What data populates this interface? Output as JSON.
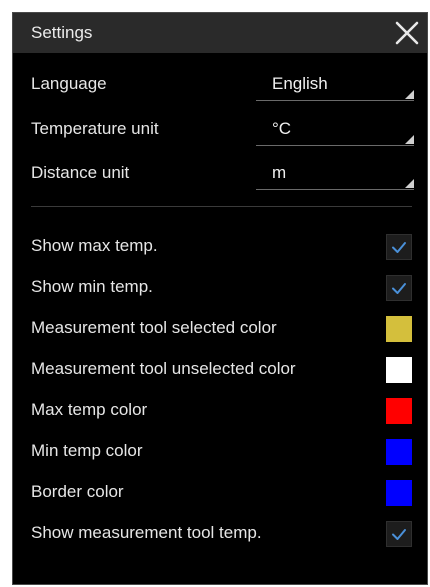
{
  "dialog": {
    "title": "Settings",
    "close_icon": "close-icon"
  },
  "selects": [
    {
      "label": "Language",
      "value": "English"
    },
    {
      "label": "Temperature unit",
      "value": "°C"
    },
    {
      "label": "Distance unit",
      "value": "m"
    }
  ],
  "options": [
    {
      "label": "Show max temp.",
      "kind": "checkbox",
      "checked": true
    },
    {
      "label": "Show min temp.",
      "kind": "checkbox",
      "checked": true
    },
    {
      "label": "Measurement tool selected color",
      "kind": "color",
      "color": "#d4bf3c"
    },
    {
      "label": "Measurement tool unselected color",
      "kind": "color",
      "color": "#ffffff"
    },
    {
      "label": "Max temp color",
      "kind": "color",
      "color": "#ff0000"
    },
    {
      "label": "Min temp color",
      "kind": "color",
      "color": "#0000ff"
    },
    {
      "label": "Border color",
      "kind": "color",
      "color": "#0000ff"
    },
    {
      "label": "Show measurement tool temp.",
      "kind": "checkbox",
      "checked": true
    }
  ],
  "colors": {
    "checkmark": "#4a90d9",
    "background": "#000000",
    "titlebar": "#2a2a2a"
  }
}
